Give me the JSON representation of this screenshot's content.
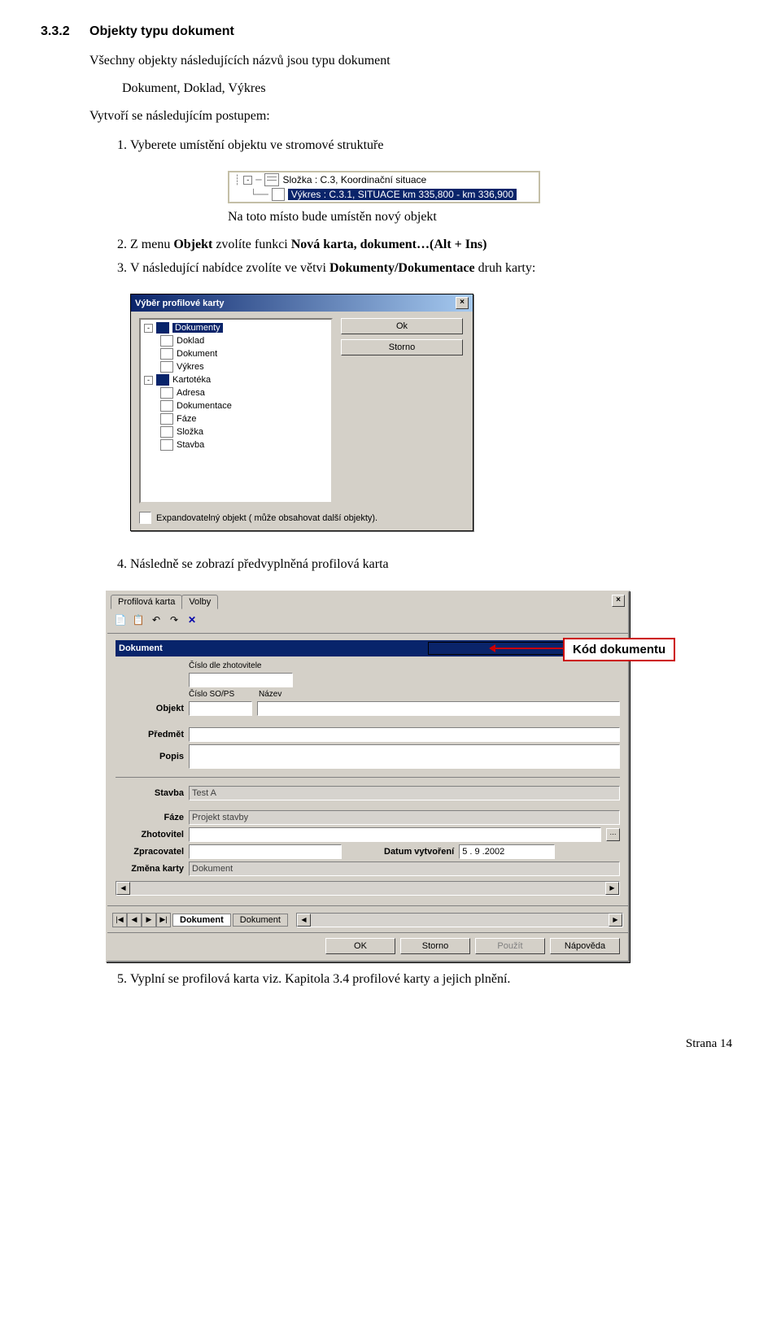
{
  "section": {
    "num": "3.3.2",
    "title": "Objekty typu dokument"
  },
  "intro": {
    "p1": "Všechny objekty následujících názvů jsou typu dokument",
    "p2": "Dokument, Doklad, Výkres",
    "p3": "Vytvoří se následujícím postupem:"
  },
  "steps": {
    "s1": "Vyberete umístění objektu ve stromové struktuře",
    "s2_a": "Z menu ",
    "s2_b": "Objekt",
    "s2_c": " zvolíte funkci ",
    "s2_d": "Nová karta, dokument…(Alt + Ins)",
    "s3_a": "V následující nabídce zvolíte ve větvi ",
    "s3_b": "Dokumenty/Dokumentace",
    "s3_c": " druh karty:",
    "s4": "Následně se zobrazí předvyplněná profilová karta",
    "s5": "Vyplní se profilová karta viz. Kapitola 3.4 profilové karty a jejich plnění."
  },
  "tree1": {
    "row1": "Složka : C.3, Koordinační situace",
    "row2": "Výkres : C.3.1, SITUACE km 335,800 - km 336,900",
    "caption": "Na toto místo bude umístěn nový objekt"
  },
  "dlg1": {
    "title": "Výběr profilové karty",
    "items": {
      "root1": "Dokumenty",
      "doklad": "Doklad",
      "dokument": "Dokument",
      "vykres": "Výkres",
      "root2": "Kartotéka",
      "adresa": "Adresa",
      "dokumentace": "Dokumentace",
      "faze": "Fáze",
      "slozka": "Složka",
      "stavba": "Stavba"
    },
    "ok": "Ok",
    "storno": "Storno",
    "checkbox": "Expandovatelný objekt ( může obsahovat další objekty)."
  },
  "callout": "Kód dokumentu",
  "dlg2": {
    "tab1": "Profilová karta",
    "tab2": "Volby",
    "header": "Dokument",
    "lbl_cislo_zhot": "Číslo dle zhotovitele",
    "lbl_cislo_sops": "Číslo SO/PS",
    "lbl_nazev": "Název",
    "lbl_objekt": "Objekt",
    "lbl_predmet": "Předmět",
    "lbl_popis": "Popis",
    "lbl_stavba": "Stavba",
    "val_stavba": "Test A",
    "lbl_faze": "Fáze",
    "val_faze": "Projekt stavby",
    "lbl_zhotovitel": "Zhotovitel",
    "lbl_zpracovatel": "Zpracovatel",
    "lbl_datum": "Datum vytvoření",
    "val_datum": " 5 . 9 .2002",
    "lbl_zmena": "Změna karty",
    "val_zmena": "Dokument",
    "btab1": "Dokument",
    "btab2": "Dokument",
    "btn_ok": "OK",
    "btn_storno": "Storno",
    "btn_pouzit": "Použít",
    "btn_napoveda": "Nápověda"
  },
  "footer": "Strana 14"
}
